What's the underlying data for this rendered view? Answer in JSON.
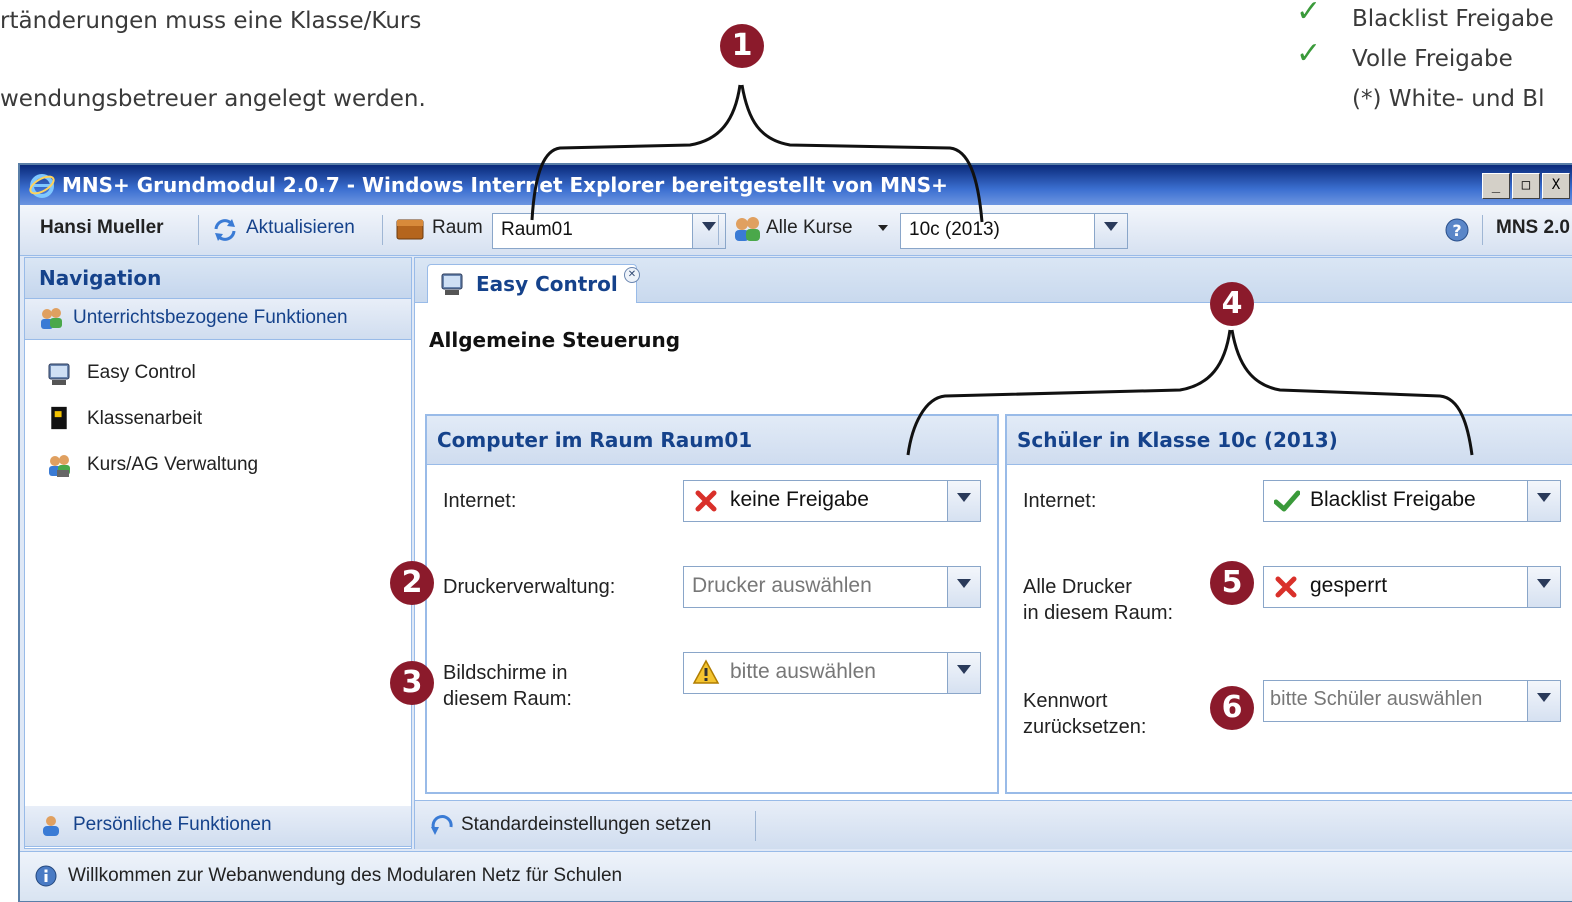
{
  "doc": {
    "line1": "rtänderungen muss eine Klasse/Kurs",
    "line2": "wendungsbetreuer angelegt werden.",
    "right_item1": "Blacklist Freigabe",
    "right_item2": "Volle Freigabe",
    "right_note": "(*) White- und Bl"
  },
  "callouts": [
    "1",
    "2",
    "3",
    "4",
    "5",
    "6"
  ],
  "window": {
    "title": "MNS+ Grundmodul 2.0.7 - Windows Internet Explorer bereitgestellt von MNS+",
    "buttons": [
      "_",
      "□",
      "X"
    ]
  },
  "toolbar": {
    "user": "Hansi Mueller",
    "refresh_label": "Aktualisieren",
    "room_label": "Raum",
    "room_value": "Raum01",
    "courses_label": "Alle Kurse",
    "course_value": "10c (2013)",
    "version": "MNS 2.0"
  },
  "nav": {
    "title": "Navigation",
    "group1": "Unterrichtsbezogene Funktionen",
    "items": [
      {
        "label": "Easy Control"
      },
      {
        "label": "Klassenarbeit"
      },
      {
        "label": "Kurs/AG Verwaltung"
      }
    ],
    "group2": "Persönliche Funktionen"
  },
  "main": {
    "tab_label": "Easy Control",
    "heading": "Allgemeine Steuerung",
    "computers": {
      "title": "Computer im Raum Raum01",
      "internet_label": "Internet:",
      "internet_value": "keine Freigabe",
      "printer_label": "Druckerverwaltung:",
      "printer_value": "Drucker auswählen",
      "screens_label": "Bildschirme in\ndiesem Raum:",
      "screens_value": "bitte auswählen"
    },
    "students": {
      "title": "Schüler in Klasse 10c (2013)",
      "internet_label": "Internet:",
      "internet_value": "Blacklist Freigabe",
      "printers_label": "Alle Drucker\nin diesem Raum:",
      "printers_value": "gesperrt",
      "password_label": "Kennwort\nzurücksetzen:",
      "password_value": "bitte Schüler auswählen"
    },
    "defaults_button": "Standardeinstellungen setzen"
  },
  "status": {
    "text": "Willkommen zur Webanwendung des Modularen Netz für Schulen"
  },
  "colors": {
    "callout": "#8b1a2b",
    "accent": "#15428b",
    "check": "#3a9a3a",
    "cross": "#d9302a"
  }
}
